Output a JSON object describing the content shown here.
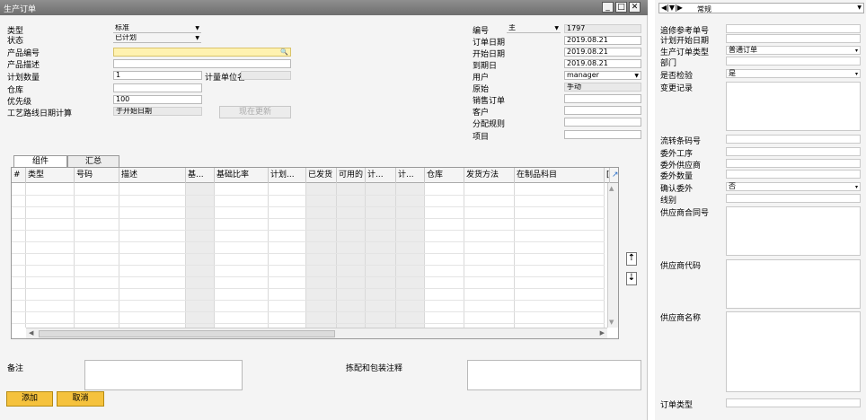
{
  "window": {
    "title": "生产订单"
  },
  "form": {
    "type_label": "类型",
    "type_value": "标准",
    "status_label": "状态",
    "status_value": "已计划",
    "product_no_label": "产品编号",
    "product_no_value": "",
    "product_desc_label": "产品描述",
    "product_desc_value": "",
    "planned_qty_label": "计划数量",
    "planned_qty_value": "1",
    "uom_label": "计量单位名",
    "warehouse_label": "仓库",
    "warehouse_value": "",
    "priority_label": "优先级",
    "priority_value": "100",
    "routing_date_label": "工艺路线日期计算",
    "routing_date_value": "于开始日期",
    "update_now_label": "现在更新"
  },
  "form_right": {
    "number_label": "编号",
    "number_series": "主",
    "number_value": "1797",
    "order_date_label": "订单日期",
    "order_date_value": "2019.08.21",
    "start_date_label": "开始日期",
    "start_date_value": "2019.08.21",
    "due_date_label": "到期日",
    "due_date_value": "2019.08.21",
    "user_label": "用户",
    "user_value": "manager",
    "origin_label": "原始",
    "origin_value": "手动",
    "sales_order_label": "销售订单",
    "customer_label": "客户",
    "distribution_rule_label": "分配规则",
    "project_label": "项目"
  },
  "tabs": [
    {
      "label": "组件"
    },
    {
      "label": "汇总"
    }
  ],
  "grid": {
    "columns": [
      "#",
      "类型",
      "号码",
      "描述",
      "基...",
      "基础比率",
      "计划...",
      "已发货",
      "可用的",
      "计...",
      "计...",
      "仓库",
      "发货方法",
      "在制品科目",
      "[",
      ""
    ]
  },
  "bottom": {
    "remarks_label": "备注",
    "pick_pack_label": "拣配和包装注释",
    "add_button": "添加",
    "cancel_button": "取消"
  },
  "right_panel": {
    "view_select": "常规",
    "fields": [
      {
        "label": "追修参考单号",
        "value": ""
      },
      {
        "label": "计划开始日期",
        "value": ""
      },
      {
        "label": "生产订单类型",
        "value": "普通订单"
      },
      {
        "label": "部门",
        "value": ""
      },
      {
        "label": "是否检验",
        "value": "是"
      },
      {
        "label": "变更记录",
        "value": ""
      },
      {
        "label": "流转条码号",
        "value": ""
      },
      {
        "label": "委外工序",
        "value": ""
      },
      {
        "label": "委外供应商",
        "value": ""
      },
      {
        "label": "委外数量",
        "value": ""
      },
      {
        "label": "确认委外",
        "value": "否"
      },
      {
        "label": "线别",
        "value": ""
      },
      {
        "label": "供应商合同号",
        "value": ""
      },
      {
        "label": "供应商代码",
        "value": ""
      },
      {
        "label": "供应商名称",
        "value": ""
      },
      {
        "label": "订单类型",
        "value": ""
      }
    ]
  },
  "colors": {
    "title_bar": "#7a7a7a",
    "accent_button": "#f5c23d",
    "product_field": "#fff2b0"
  }
}
